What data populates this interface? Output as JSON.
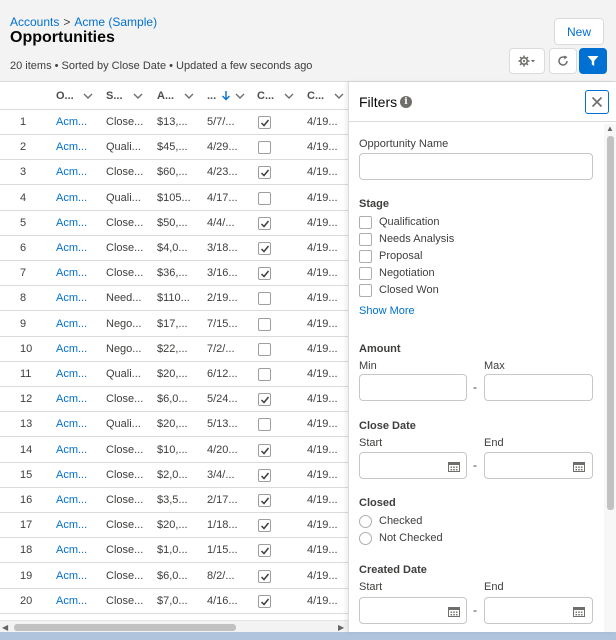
{
  "header": {
    "breadcrumb": {
      "root": "Accounts",
      "separator": ">",
      "current": "Acme (Sample)"
    },
    "title": "Opportunities",
    "summary": "20 items • Sorted by Close Date • Updated a few seconds ago",
    "new_label": "New"
  },
  "table": {
    "columns": [
      "O...",
      "S...",
      "A...",
      "...",
      "C...",
      "C..."
    ],
    "rows": [
      {
        "num": "1",
        "name": "Acm...",
        "stage": "Close...",
        "amount": "$13,...",
        "close": "5/7/...",
        "closed": true,
        "created": "4/19..."
      },
      {
        "num": "2",
        "name": "Acm...",
        "stage": "Quali...",
        "amount": "$45,...",
        "close": "4/29...",
        "closed": false,
        "created": "4/19..."
      },
      {
        "num": "3",
        "name": "Acm...",
        "stage": "Close...",
        "amount": "$60,...",
        "close": "4/23...",
        "closed": true,
        "created": "4/19..."
      },
      {
        "num": "4",
        "name": "Acm...",
        "stage": "Quali...",
        "amount": "$105...",
        "close": "4/17...",
        "closed": false,
        "created": "4/19..."
      },
      {
        "num": "5",
        "name": "Acm...",
        "stage": "Close...",
        "amount": "$50,...",
        "close": "4/4/...",
        "closed": true,
        "created": "4/19..."
      },
      {
        "num": "6",
        "name": "Acm...",
        "stage": "Close...",
        "amount": "$4,0...",
        "close": "3/18...",
        "closed": true,
        "created": "4/19..."
      },
      {
        "num": "7",
        "name": "Acm...",
        "stage": "Close...",
        "amount": "$36,...",
        "close": "3/16...",
        "closed": true,
        "created": "4/19..."
      },
      {
        "num": "8",
        "name": "Acm...",
        "stage": "Need...",
        "amount": "$110...",
        "close": "2/19...",
        "closed": false,
        "created": "4/19..."
      },
      {
        "num": "9",
        "name": "Acm...",
        "stage": "Nego...",
        "amount": "$17,...",
        "close": "7/15...",
        "closed": false,
        "created": "4/19..."
      },
      {
        "num": "10",
        "name": "Acm...",
        "stage": "Nego...",
        "amount": "$22,...",
        "close": "7/2/...",
        "closed": false,
        "created": "4/19..."
      },
      {
        "num": "11",
        "name": "Acm...",
        "stage": "Quali...",
        "amount": "$20,...",
        "close": "6/12...",
        "closed": false,
        "created": "4/19..."
      },
      {
        "num": "12",
        "name": "Acm...",
        "stage": "Close...",
        "amount": "$6,0...",
        "close": "5/24...",
        "closed": true,
        "created": "4/19..."
      },
      {
        "num": "13",
        "name": "Acm...",
        "stage": "Quali...",
        "amount": "$20,...",
        "close": "5/13...",
        "closed": false,
        "created": "4/19..."
      },
      {
        "num": "14",
        "name": "Acm...",
        "stage": "Close...",
        "amount": "$10,...",
        "close": "4/20...",
        "closed": true,
        "created": "4/19..."
      },
      {
        "num": "15",
        "name": "Acm...",
        "stage": "Close...",
        "amount": "$2,0...",
        "close": "3/4/...",
        "closed": true,
        "created": "4/19..."
      },
      {
        "num": "16",
        "name": "Acm...",
        "stage": "Close...",
        "amount": "$3,5...",
        "close": "2/17...",
        "closed": true,
        "created": "4/19..."
      },
      {
        "num": "17",
        "name": "Acm...",
        "stage": "Close...",
        "amount": "$20,...",
        "close": "1/18...",
        "closed": true,
        "created": "4/19..."
      },
      {
        "num": "18",
        "name": "Acm...",
        "stage": "Close...",
        "amount": "$1,0...",
        "close": "1/15...",
        "closed": true,
        "created": "4/19..."
      },
      {
        "num": "19",
        "name": "Acm...",
        "stage": "Close...",
        "amount": "$6,0...",
        "close": "8/2/...",
        "closed": true,
        "created": "4/19..."
      },
      {
        "num": "20",
        "name": "Acm...",
        "stage": "Close...",
        "amount": "$7,0...",
        "close": "4/16...",
        "closed": true,
        "created": "4/19..."
      }
    ]
  },
  "filters": {
    "title": "Filters",
    "info_icon": "i",
    "opportunity_name": "Opportunity Name",
    "stage": {
      "label": "Stage",
      "options": [
        "Qualification",
        "Needs Analysis",
        "Proposal",
        "Negotiation",
        "Closed Won"
      ],
      "show_more": "Show More"
    },
    "amount": {
      "label": "Amount",
      "min": "Min",
      "max": "Max",
      "dash": "-"
    },
    "close_date": {
      "label": "Close Date",
      "start": "Start",
      "end": "End",
      "dash": "-"
    },
    "closed": {
      "label": "Closed",
      "options": [
        "Checked",
        "Not Checked"
      ]
    },
    "created_date": {
      "label": "Created Date",
      "start": "Start",
      "end": "End",
      "dash": "-"
    }
  },
  "colors": {
    "brand": "#0070d2",
    "header_bg": "#f3f3f3",
    "border": "#dddbda"
  }
}
